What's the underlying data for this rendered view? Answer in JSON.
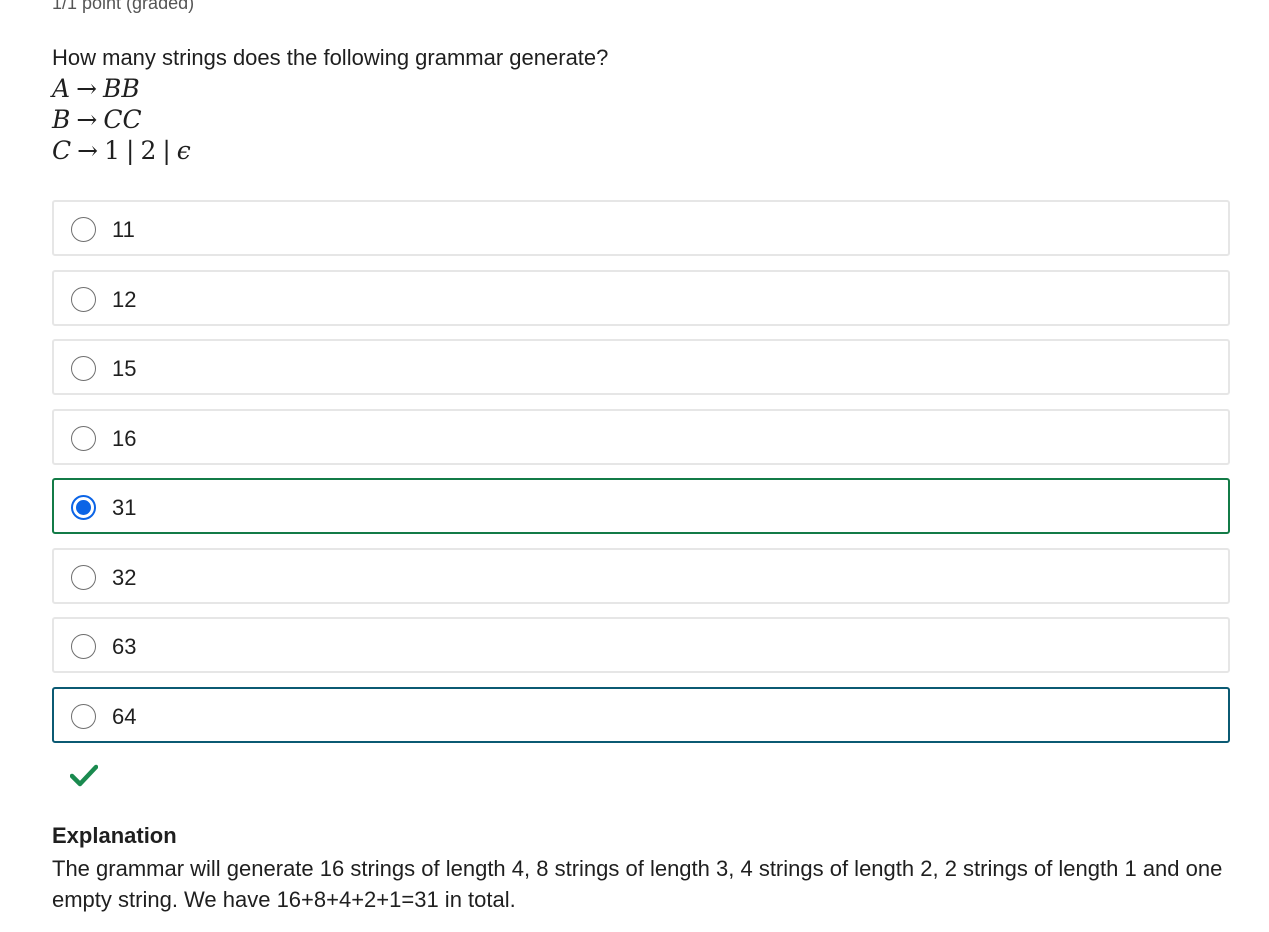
{
  "points": "1/1 point (graded)",
  "question": "How many strings does the following grammar generate?",
  "grammar": {
    "rules": [
      {
        "lhs": "A",
        "arrow": "→",
        "rhs": "BB"
      },
      {
        "lhs": "B",
        "arrow": "→",
        "rhs": "CC"
      },
      {
        "lhs": "C",
        "arrow": "→",
        "rhs_parts": [
          "1",
          "|",
          "2",
          "|",
          "ϵ"
        ]
      }
    ]
  },
  "options": [
    {
      "label": "11",
      "state": "default"
    },
    {
      "label": "12",
      "state": "default"
    },
    {
      "label": "15",
      "state": "default"
    },
    {
      "label": "16",
      "state": "default"
    },
    {
      "label": "31",
      "state": "selected"
    },
    {
      "label": "32",
      "state": "default"
    },
    {
      "label": "63",
      "state": "default"
    },
    {
      "label": "64",
      "state": "focused"
    }
  ],
  "result_icon": "checkmark-icon",
  "explanation": {
    "title": "Explanation",
    "text": "The grammar will generate 16 strings of length 4, 8 strings of length 3, 4 strings of length 2, 2 strings of length 1 and one empty string. We have 16+8+4+2+1=31 in total."
  },
  "colors": {
    "correct_border": "#137b47",
    "focus_border": "#0b5a73",
    "radio_selected": "#0b64e6",
    "check": "#1a8a4f"
  }
}
